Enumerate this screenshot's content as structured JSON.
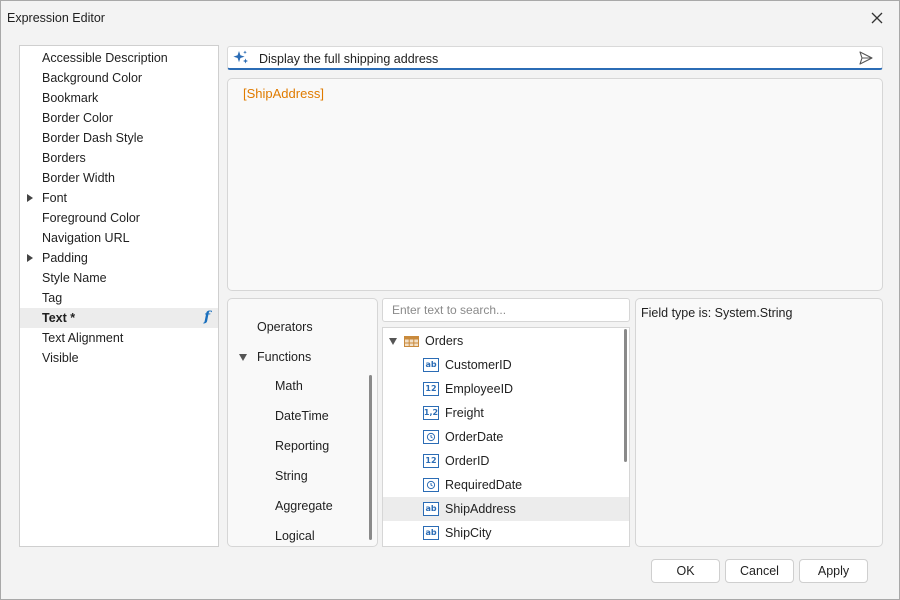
{
  "window": {
    "title": "Expression Editor"
  },
  "properties": {
    "items": [
      {
        "label": "Accessible Description"
      },
      {
        "label": "Background Color"
      },
      {
        "label": "Bookmark"
      },
      {
        "label": "Border Color"
      },
      {
        "label": "Border Dash Style"
      },
      {
        "label": "Borders"
      },
      {
        "label": "Border Width"
      },
      {
        "label": "Font",
        "expandable": true
      },
      {
        "label": "Foreground Color"
      },
      {
        "label": "Navigation URL"
      },
      {
        "label": "Padding",
        "expandable": true
      },
      {
        "label": "Style Name"
      },
      {
        "label": "Tag"
      },
      {
        "label": "Text *",
        "selected": true,
        "has_expression": true
      },
      {
        "label": "Text Alignment"
      },
      {
        "label": "Visible"
      }
    ],
    "expression_indicator": "f"
  },
  "prompt": {
    "text": "Display the full shipping address",
    "icon": "sparkle-icon",
    "send_icon": "send-icon"
  },
  "expression": {
    "text": "[ShipAddress]",
    "color": "#e07b00"
  },
  "categories": {
    "items": [
      {
        "label": "Operators",
        "level": 0
      },
      {
        "label": "Functions",
        "level": 0,
        "expanded": true
      },
      {
        "label": "Math",
        "level": 1
      },
      {
        "label": "DateTime",
        "level": 1
      },
      {
        "label": "Reporting",
        "level": 1
      },
      {
        "label": "String",
        "level": 1
      },
      {
        "label": "Aggregate",
        "level": 1
      },
      {
        "label": "Logical",
        "level": 1
      }
    ]
  },
  "search": {
    "placeholder": "Enter text to search..."
  },
  "fields": {
    "root": {
      "label": "Orders",
      "icon": "table-icon",
      "expanded": true
    },
    "items": [
      {
        "label": "CustomerID",
        "type_badge": "ab"
      },
      {
        "label": "EmployeeID",
        "type_badge": "12"
      },
      {
        "label": "Freight",
        "type_badge": "1,2"
      },
      {
        "label": "OrderDate",
        "type_badge": "date"
      },
      {
        "label": "OrderID",
        "type_badge": "12"
      },
      {
        "label": "RequiredDate",
        "type_badge": "date"
      },
      {
        "label": "ShipAddress",
        "type_badge": "ab",
        "selected": true
      },
      {
        "label": "ShipCity",
        "type_badge": "ab"
      }
    ]
  },
  "description": {
    "text": "Field type is: System.String"
  },
  "buttons": {
    "ok": "OK",
    "cancel": "Cancel",
    "apply": "Apply"
  },
  "colors": {
    "accent": "#2b6cb5",
    "expression": "#e07b00",
    "selection": "#ececec"
  }
}
